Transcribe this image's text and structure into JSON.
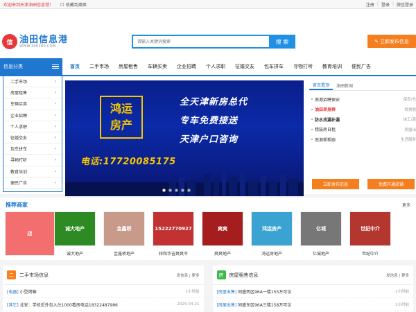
{
  "topbar": {
    "welcome": "欢迎来到天津油田信息港！",
    "favorite": "收藏到桌面",
    "register": "注册",
    "login": "登录",
    "wechat_login": "微信登录"
  },
  "header": {
    "logo_mark": "信",
    "logo_name": "油田信息港",
    "logo_url": "WWW.300280.COM",
    "search_placeholder": "请输入关键词搜索",
    "search_button": "搜 索",
    "publish_button": "立即发布信息"
  },
  "categories_title": "信息分类",
  "nav": [
    "首页",
    "二手市场",
    "房屋租售",
    "车辆买卖",
    "企业招聘",
    "个人求职",
    "征婚交友",
    "包车拼车",
    "寻物打听",
    "教育培训",
    "便民广告"
  ],
  "sidebar": [
    "二手市场",
    "房屋租售",
    "车辆买卖",
    "企业招聘",
    "个人求职",
    "征婚交友",
    "包车拼车",
    "寻物打听",
    "教育培训",
    "便民广告"
  ],
  "banner": {
    "brand_line1": "鸿运",
    "brand_line2": "房产",
    "line1": "全天津新房总代",
    "line2": "专车免费接送",
    "line3": "天津户口咨询",
    "phone": "电话:17720085175"
  },
  "news": {
    "tabs": [
      "首页置顶",
      "油田新闻"
    ],
    "items": [
      {
        "title": "南港招聘保安",
        "right": "保安/仓"
      },
      {
        "title": "油田单身群",
        "right": "找男朋"
      },
      {
        "title": "防水找漏补漏",
        "right": "抹工/混"
      },
      {
        "title": "精装房日租",
        "right": "房屋出"
      },
      {
        "title": "南港帮帮跑",
        "right": "生活服务"
      }
    ],
    "btn_publish": "立即发布信息",
    "btn_open": "免费开通店铺"
  },
  "recommend": {
    "title": "推荐商家",
    "more": "更多",
    "items": [
      {
        "name": "",
        "label": "店",
        "color": "#f36f6f"
      },
      {
        "name": "诚大地产",
        "label": "诚大地产",
        "color": "#2e8b23"
      },
      {
        "name": "金鑫桥地产",
        "label": "金鑫桥",
        "color": "#c89a8a"
      },
      {
        "name": "祥和华吉爽爽不",
        "label": "15222770927",
        "color": "#c23232"
      },
      {
        "name": "爽爽地产",
        "label": "爽爽",
        "color": "#a51d1d"
      },
      {
        "name": "鸿运房地产",
        "label": "鸿运房产",
        "color": "#3aa3d1"
      },
      {
        "name": "亿城地产",
        "label": "亿城",
        "color": "#777777"
      },
      {
        "name": "世纪中介",
        "label": "世纪中介",
        "color": "#b3362f"
      }
    ]
  },
  "panels": [
    {
      "icon": "二",
      "title": "二手市场信息",
      "more": "发信息 | 更多",
      "rows": [
        {
          "tag": "[电器]",
          "text": "小型烤箱",
          "time": "1小时前"
        },
        {
          "tag": "[其它]",
          "text": "北安：学校近外包入住1000看房电话18322487986",
          "time": "2025-04-21"
        }
      ]
    },
    {
      "icon": "房",
      "title": "房屋租售信息",
      "more": "发信息 | 更多",
      "rows": [
        {
          "tag": "[房屋出售]",
          "text": "同盛西区96A一楼155万可议",
          "time": "1小时前"
        },
        {
          "tag": "[房屋出售]",
          "text": "同盛东区96A三楼158万可议",
          "time": "1小时前"
        }
      ]
    }
  ],
  "colors": {
    "brand_blue": "#1f77d0",
    "accent_orange": "#f57e1f",
    "accent_red": "#e4393c"
  }
}
